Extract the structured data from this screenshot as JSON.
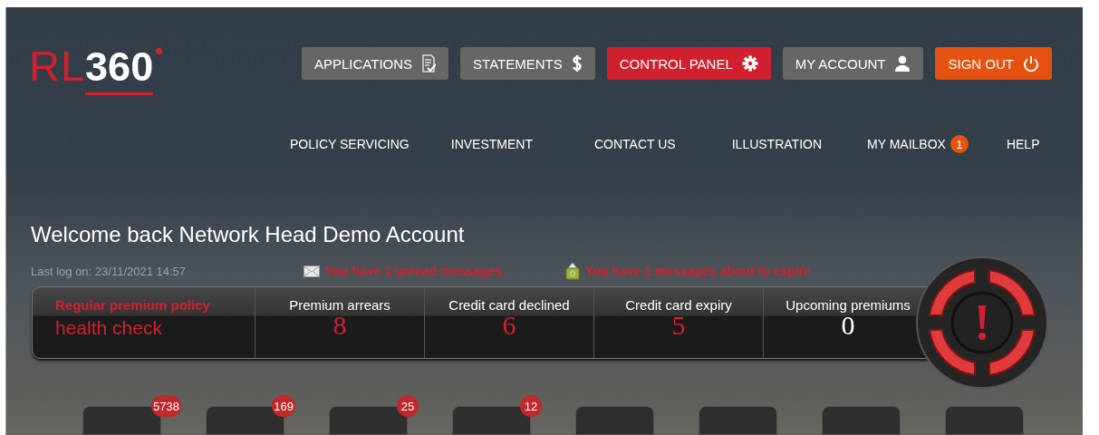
{
  "logo": {
    "prefix": "RL",
    "suffix": "360"
  },
  "buttons": [
    {
      "label": "APPLICATIONS",
      "kind": "normal"
    },
    {
      "label": "STATEMENTS",
      "kind": "normal"
    },
    {
      "label": "CONTROL PANEL",
      "kind": "active"
    },
    {
      "label": "MY ACCOUNT",
      "kind": "normal"
    },
    {
      "label": "SIGN OUT",
      "kind": "signout"
    }
  ],
  "nav": [
    {
      "label": "POLICY SERVICING"
    },
    {
      "label": "INVESTMENT"
    },
    {
      "label": "CONTACT US"
    },
    {
      "label": "ILLUSTRATION"
    },
    {
      "label": "MY MAILBOX",
      "badge": "1"
    },
    {
      "label": "HELP"
    }
  ],
  "welcome": "Welcome back Network Head Demo Account",
  "last_log": "Last log on: 23/11/2021 14:57",
  "notices": [
    {
      "text": "You have 1 unread messages",
      "kind": "mail"
    },
    {
      "text": "You have 1 messages about to expire",
      "kind": "expire"
    }
  ],
  "health": {
    "title": "Regular premium policy",
    "subtitle": "health check",
    "cells": [
      {
        "label": "Premium arrears",
        "value": "8",
        "alert": true
      },
      {
        "label": "Credit card declined",
        "value": "6",
        "alert": true
      },
      {
        "label": "Credit card expiry",
        "value": "5",
        "alert": true
      },
      {
        "label": "Upcoming premiums",
        "value": "0",
        "alert": false
      }
    ]
  },
  "tiles": [
    {
      "kind": "badged",
      "badge": "5738"
    },
    {
      "kind": "badged",
      "badge": "169"
    },
    {
      "kind": "badged",
      "badge": "25"
    },
    {
      "kind": "badged",
      "badge": "12"
    },
    {
      "kind": "plain"
    },
    {
      "kind": "plain"
    },
    {
      "kind": "plain"
    },
    {
      "kind": "plain"
    }
  ]
}
